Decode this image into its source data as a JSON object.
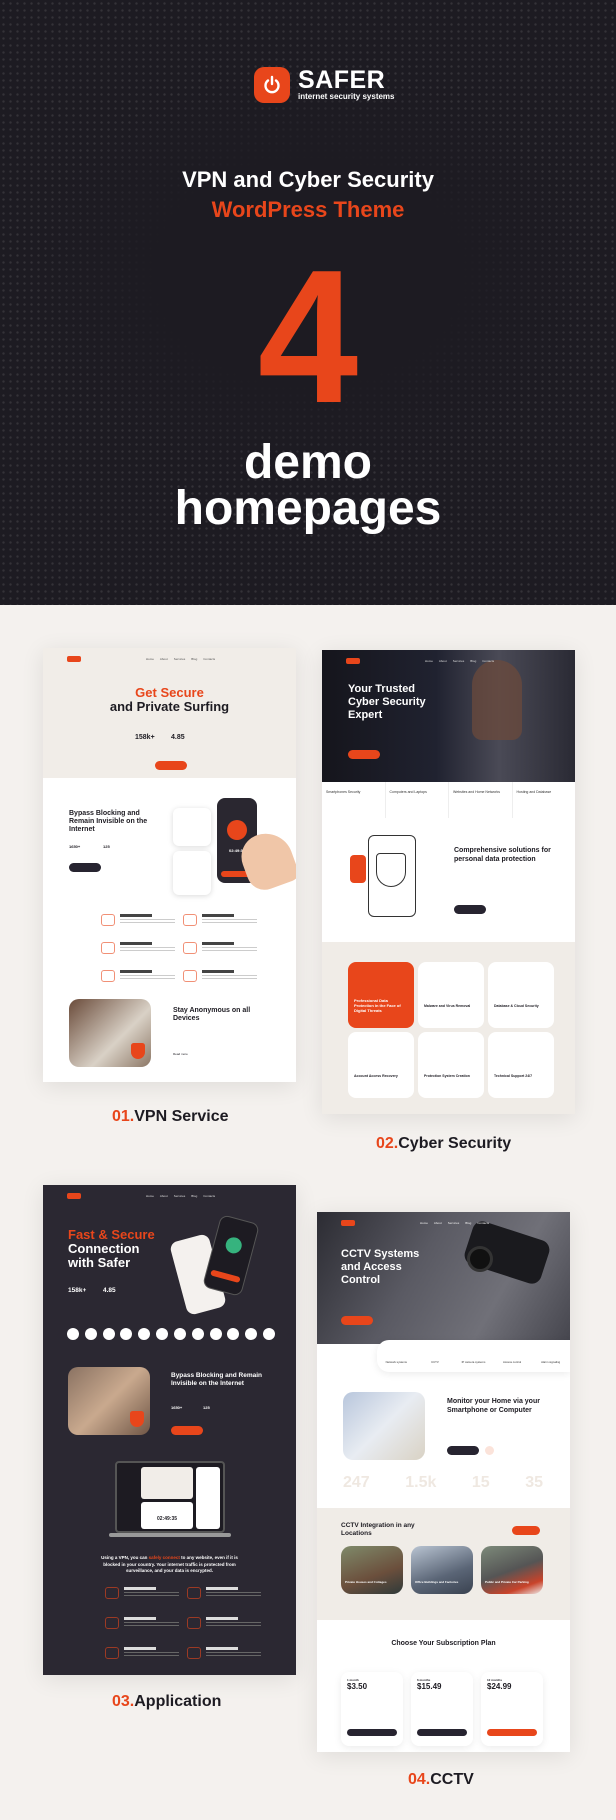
{
  "brand": {
    "name": "SAFER",
    "subtitle": "internet security systems",
    "accent": "#e8461b",
    "dark": "#1d1b22"
  },
  "hero": {
    "line1": "VPN and Cyber Security",
    "line2": "WordPress Theme",
    "count": "4",
    "demo_line1": "demo",
    "demo_line2": "homepages"
  },
  "nav_items": [
    "Home",
    "About",
    "Services",
    "Blog",
    "Contacts"
  ],
  "demos": [
    {
      "number": "01.",
      "name": "VPN Service",
      "hero_title_1": "Get Secure",
      "hero_title_2": "and Private Surfing",
      "stat1": "158k+",
      "stat2": "4.85",
      "section_title": "Bypass Blocking and Remain Invisible on the Internet",
      "mini_stats": [
        "1650+",
        "125"
      ],
      "phone_timer": "02:49:35",
      "features": [
        "High speed connection",
        "IP address protection",
        "No activity logs policy",
        "Reliable encryption",
        "Unlimited traffic",
        "24/7 user support"
      ],
      "section2_title": "Stay Anonymous on all Devices",
      "read_more": "Read more"
    },
    {
      "number": "02.",
      "name": "Cyber Security",
      "hero_title": "Your Trusted Cyber Security Expert",
      "categories": [
        "Smartphones Security",
        "Computers and Laptops",
        "Websites and Home Networks",
        "Hosting and Database"
      ],
      "section_title": "Comprehensive solutions for personal data protection",
      "featured_card": "Professional Data Protection in the Face of Digital Threats",
      "services": [
        "Malware and Virus Removal",
        "Database & Cloud Security",
        "Account Access Recovery",
        "Protection System Creation",
        "Technical Support 24/7"
      ]
    },
    {
      "number": "03.",
      "name": "Application",
      "hero_title_1": "Fast & Secure",
      "hero_title_2": "Connection with Safer",
      "stat1": "158k+",
      "stat2": "4.85",
      "platforms": [
        "Windows",
        "Apple",
        "Android",
        "Linux",
        "Router",
        "Chrome",
        "Firefox",
        "Edge",
        "Playstation",
        "X-Box",
        "Apple TV",
        "Other"
      ],
      "section_title": "Bypass Blocking and Remain Invisible on the Internet",
      "mini_stats": [
        "1650+",
        "125"
      ],
      "laptop_timer": "02:49:35",
      "statement_pre": "Using a VPN, you can ",
      "statement_highlight": "safely connect",
      "statement_post": " to any website, even if it is blocked in your country. Your internet traffic is protected from surveillance, and your data is encrypted.",
      "features": [
        "High speed connection",
        "IP address protection",
        "No activity logs policy",
        "Reliable encryption",
        "Unlimited traffic",
        "24/7 user support"
      ]
    },
    {
      "number": "04.",
      "name": "CCTV",
      "hero_title": "CCTV Systems and Access Control",
      "categories": [
        "Network systems",
        "CCTV",
        "IP camera systems",
        "Access control",
        "Alarm signaling"
      ],
      "section_title": "Monitor your Home via your Smartphone or Computer",
      "counters": [
        "247",
        "1.5k",
        "15",
        "35"
      ],
      "integration_title": "CCTV Integration in any Locations",
      "locations": [
        "Private Houses and Cottages",
        "Office Buildings and Factories",
        "Public and Private Car Parking"
      ],
      "pricing_title": "Choose Your Subscription Plan",
      "plans": [
        {
          "period": "1 month",
          "price": "3.50"
        },
        {
          "period": "6 months",
          "price": "15.49"
        },
        {
          "period": "12 months",
          "price": "24.99"
        }
      ]
    }
  ]
}
